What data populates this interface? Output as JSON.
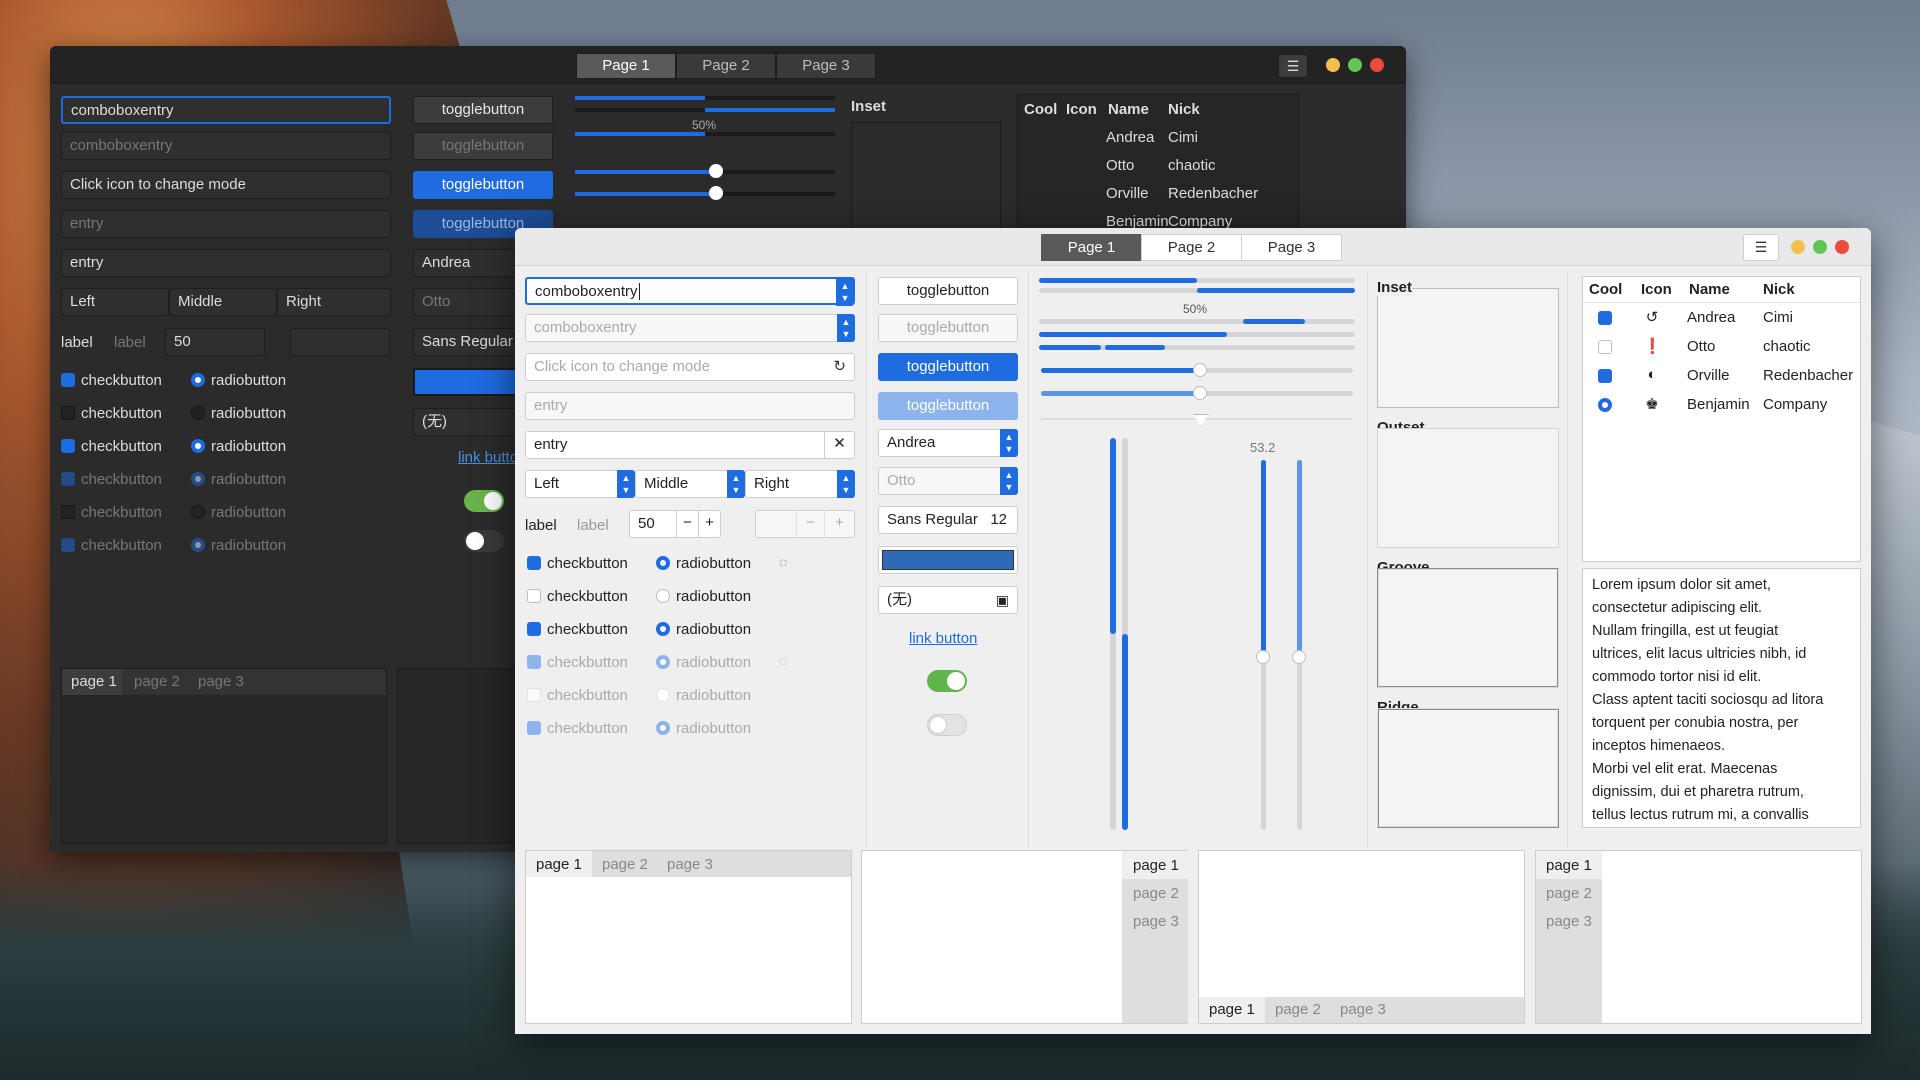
{
  "tabs": [
    "Page 1",
    "Page 2",
    "Page 3"
  ],
  "combo": {
    "entry1": "comboboxentry",
    "entry2": "comboboxentry"
  },
  "entries": {
    "mode": "Click icon to change mode",
    "placeholder": "entry",
    "entry": "entry"
  },
  "segments": [
    "Left",
    "Middle",
    "Right"
  ],
  "spin": {
    "label1": "label",
    "label2": "label",
    "value": "50"
  },
  "toggle": "togglebutton",
  "checks": [
    "checkbutton",
    "checkbutton",
    "checkbutton",
    "checkbutton",
    "checkbutton",
    "checkbutton"
  ],
  "radios": [
    "radiobutton",
    "radiobutton",
    "radiobutton",
    "radiobutton",
    "radiobutton",
    "radiobutton"
  ],
  "combos": {
    "andrea": "Andrea",
    "otto": "Otto"
  },
  "font": {
    "name": "Sans Regular",
    "size": "12"
  },
  "file": "(无)",
  "link": "link button",
  "progress": {
    "label": "50%",
    "value": 0.5
  },
  "scale_value": "53.2",
  "frames": [
    "Inset",
    "Outset",
    "Groove",
    "Ridge"
  ],
  "tree": {
    "headers": [
      "Cool",
      "Icon",
      "Name",
      "Nick"
    ],
    "rows": [
      {
        "name": "Andrea",
        "nick": "Cimi"
      },
      {
        "name": "Otto",
        "nick": "chaotic"
      },
      {
        "name": "Orville",
        "nick": "Redenbacher"
      },
      {
        "name": "Benjamin",
        "nick": "Company"
      }
    ]
  },
  "lorem": [
    "Lorem ipsum dolor sit amet,",
    "consectetur adipiscing elit.",
    "Nullam fringilla, est ut feugiat",
    "ultrices, elit lacus ultricies nibh, id",
    "commodo tortor nisi id elit.",
    "Class aptent taciti sociosqu ad litora",
    "torquent per conubia nostra, per",
    "inceptos himenaeos.",
    "Morbi vel elit erat. Maecenas",
    "dignissim, dui et pharetra rutrum,",
    "tellus lectus rutrum mi, a convallis"
  ],
  "nbtabs": [
    "page 1",
    "page 2",
    "page 3"
  ],
  "dark_tree": {
    "rows": [
      {
        "name": "Andrea",
        "nick": "Cimi"
      },
      {
        "name": "Otto",
        "nick": "chaotic"
      },
      {
        "name": "Orville",
        "nick": "Redenbacher"
      },
      {
        "name": "Benjamin",
        "nick": "Company"
      }
    ]
  },
  "colors": {
    "accent": "#1e6ce0",
    "close": "#e94b3c",
    "min": "#f4bf4f",
    "max": "#61c554"
  }
}
